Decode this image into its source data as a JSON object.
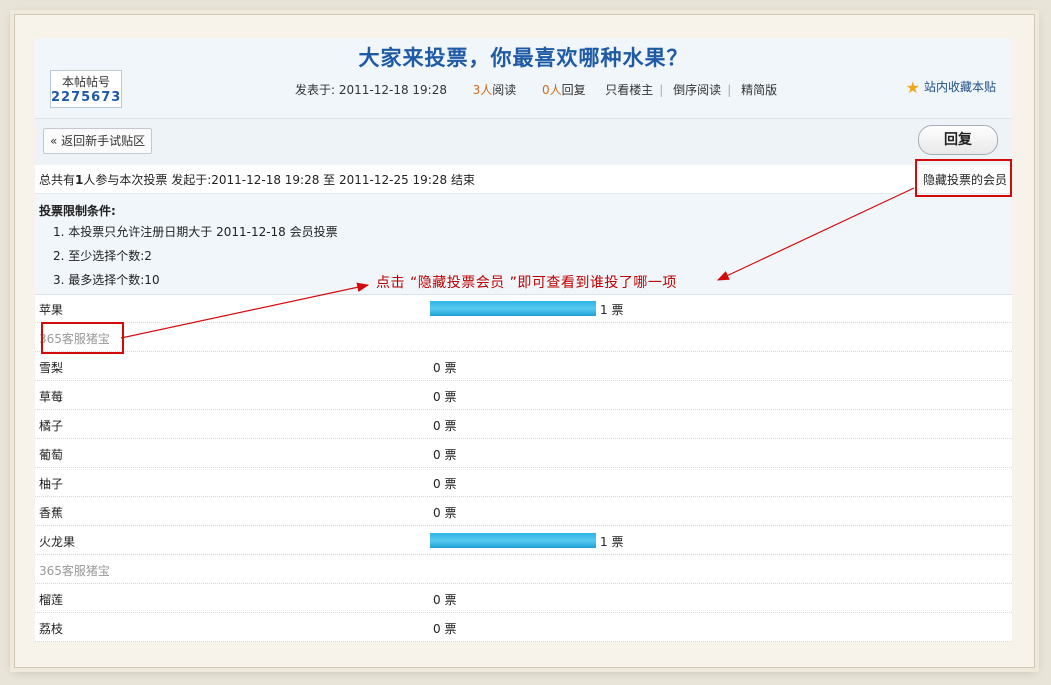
{
  "header": {
    "title": "大家来投票，你最喜欢哪种水果？",
    "post_id_label": "本帖帖号",
    "post_id": "2275673",
    "posted_label": "发表于: 2011-12-18 19:28",
    "read_count": "3人",
    "read_label": "阅读",
    "reply_count": "0人",
    "reply_label": "回复",
    "links": [
      "只看楼主",
      "倒序阅读",
      "精简版"
    ],
    "favorite_label": "站内收藏本贴"
  },
  "toolbar": {
    "back_label": "« 返回新手试贴区",
    "reply_label": "回复"
  },
  "poll": {
    "summary_prefix": "总共有",
    "summary_count": "1",
    "summary_suffix": "人参与本次投票 发起于:2011-12-18 19:28 至 2011-12-25 19:28 结束",
    "hide_voters_label": "隐藏投票的会员",
    "conditions_title": "投票限制条件:",
    "conditions": [
      "1.  本投票只允许注册日期大于 2011-12-18 会员投票",
      "2.  至少选择个数:2",
      "3.  最多选择个数:10"
    ],
    "options": [
      {
        "label": "苹果",
        "votes": "1 票",
        "share": 1,
        "voters": "365客服猪宝"
      },
      {
        "label": "雪梨",
        "votes": "0 票",
        "share": 0
      },
      {
        "label": "草莓",
        "votes": "0 票",
        "share": 0
      },
      {
        "label": "橘子",
        "votes": "0 票",
        "share": 0
      },
      {
        "label": "葡萄",
        "votes": "0 票",
        "share": 0
      },
      {
        "label": "柚子",
        "votes": "0 票",
        "share": 0
      },
      {
        "label": "香蕉",
        "votes": "0 票",
        "share": 0
      },
      {
        "label": "火龙果",
        "votes": "1 票",
        "share": 1,
        "voters": "365客服猪宝"
      },
      {
        "label": "榴莲",
        "votes": "0 票",
        "share": 0
      },
      {
        "label": "荔枝",
        "votes": "0 票",
        "share": 0
      }
    ]
  },
  "annotation": {
    "text": "点击 “隐藏投票会员 ”即可查看到谁投了哪一项",
    "color": "#c00000"
  },
  "colors": {
    "title": "#1f5aa6",
    "bar": "#2cb6e6",
    "header_bg": "#f0f6fa"
  }
}
